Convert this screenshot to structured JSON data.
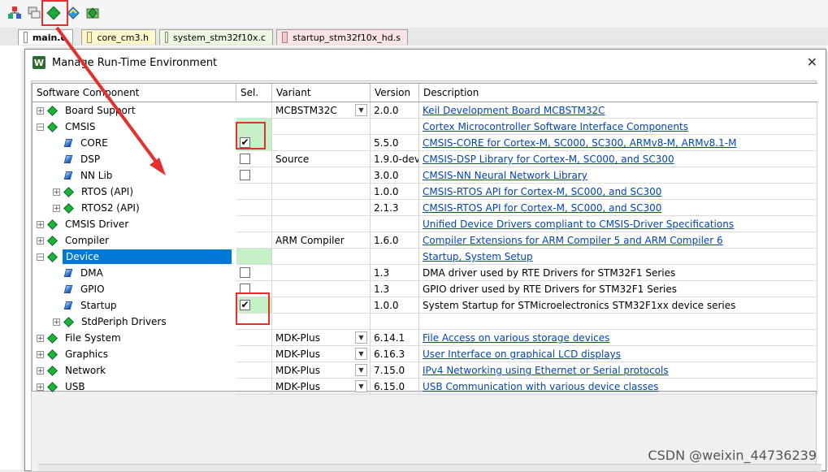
{
  "tabs": [
    {
      "label": "main.c",
      "active": true
    },
    {
      "label": "core_cm3.h",
      "active": false
    },
    {
      "label": "system_stm32f10x.c",
      "active": false
    },
    {
      "label": "startup_stm32f10x_hd.s",
      "active": false
    }
  ],
  "dialog": {
    "icon": "W",
    "title": "Manage Run-Time Environment",
    "close": "✕"
  },
  "columns": {
    "component": "Software Component",
    "sel": "Sel.",
    "variant": "Variant",
    "version": "Version",
    "description": "Description"
  },
  "rows": [
    {
      "level": 0,
      "expander": "+",
      "icon": "green-diamond",
      "name": "Board Support",
      "variant": "MCBSTM32C",
      "has_dropdown": true,
      "version": "2.0.0",
      "desc": "Keil Development Board MCBSTM32C",
      "desc_link": true
    },
    {
      "level": 0,
      "expander": "−",
      "icon": "green-diamond",
      "name": "CMSIS",
      "variant": "",
      "version": "",
      "desc": "Cortex Microcontroller Software Interface Components",
      "desc_link": true,
      "sel_green": true
    },
    {
      "level": 1,
      "icon": "blue-diamond",
      "name": "CORE",
      "checkbox": true,
      "checked": true,
      "sel_green": true,
      "version": "5.5.0",
      "desc": "CMSIS-CORE for Cortex-M, SC000, SC300, ARMv8-M, ARMv8.1-M",
      "desc_link": true
    },
    {
      "level": 1,
      "icon": "blue-diamond",
      "name": "DSP",
      "checkbox": true,
      "checked": false,
      "variant": "Source",
      "version": "1.9.0-dev",
      "desc": "CMSIS-DSP Library for Cortex-M, SC000, and SC300",
      "desc_link": true
    },
    {
      "level": 1,
      "icon": "blue-diamond",
      "name": "NN Lib",
      "checkbox": true,
      "checked": false,
      "version": "3.0.0",
      "desc": "CMSIS-NN Neural Network Library",
      "desc_link": true
    },
    {
      "level": 1,
      "expander": "+",
      "icon": "green-diamond",
      "name": "RTOS (API)",
      "version": "1.0.0",
      "desc": "CMSIS-RTOS API for Cortex-M, SC000, and SC300",
      "desc_link": true
    },
    {
      "level": 1,
      "expander": "+",
      "icon": "green-diamond",
      "name": "RTOS2 (API)",
      "version": "2.1.3",
      "desc": "CMSIS-RTOS API for Cortex-M, SC000, and SC300",
      "desc_link": true
    },
    {
      "level": 0,
      "expander": "+",
      "icon": "green-diamond",
      "name": "CMSIS Driver",
      "version": "",
      "desc": "Unified Device Drivers compliant to CMSIS-Driver Specifications",
      "desc_link": true
    },
    {
      "level": 0,
      "expander": "+",
      "icon": "green-diamond",
      "name": "Compiler",
      "variant": "ARM Compiler",
      "version": "1.6.0",
      "desc": "Compiler Extensions for ARM Compiler 5 and ARM Compiler 6",
      "desc_link": true
    },
    {
      "level": 0,
      "expander": "−",
      "icon": "green-diamond",
      "name": "Device",
      "selected": true,
      "sel_green": true,
      "version": "",
      "desc": "Startup, System Setup",
      "desc_link": true
    },
    {
      "level": 1,
      "icon": "blue-diamond",
      "name": "DMA",
      "checkbox": true,
      "checked": false,
      "version": "1.3",
      "desc": "DMA driver used by RTE Drivers for STM32F1 Series",
      "desc_link": false
    },
    {
      "level": 1,
      "icon": "blue-diamond",
      "name": "GPIO",
      "checkbox": true,
      "checked": false,
      "version": "1.3",
      "desc": "GPIO driver used by RTE Drivers for STM32F1 Series",
      "desc_link": false
    },
    {
      "level": 1,
      "icon": "blue-diamond",
      "name": "Startup",
      "checkbox": true,
      "checked": true,
      "sel_green": true,
      "version": "1.0.0",
      "desc": "System Startup for STMicroelectronics STM32F1xx device series",
      "desc_link": false
    },
    {
      "level": 1,
      "expander": "+",
      "icon": "green-diamond",
      "name": "StdPeriph Drivers",
      "version": "",
      "desc": "",
      "desc_link": false
    },
    {
      "level": 0,
      "expander": "+",
      "icon": "green-diamond",
      "name": "File System",
      "variant": "MDK-Plus",
      "has_dropdown": true,
      "version": "6.14.1",
      "desc": "File Access on various storage devices",
      "desc_link": true
    },
    {
      "level": 0,
      "expander": "+",
      "icon": "green-diamond",
      "name": "Graphics",
      "variant": "MDK-Plus",
      "has_dropdown": true,
      "version": "6.16.3",
      "desc": "User Interface on graphical LCD displays",
      "desc_link": true
    },
    {
      "level": 0,
      "expander": "+",
      "icon": "green-diamond",
      "name": "Network",
      "variant": "MDK-Plus",
      "has_dropdown": true,
      "version": "7.15.0",
      "desc": "IPv4 Networking using Ethernet or Serial protocols",
      "desc_link": true
    },
    {
      "level": 0,
      "expander": "+",
      "icon": "green-diamond",
      "name": "USB",
      "variant": "MDK-Plus",
      "has_dropdown": true,
      "version": "6.15.0",
      "desc": "USB Communication with various device classes",
      "desc_link": true
    }
  ],
  "watermark": "CSDN @weixin_44736239",
  "colors": {
    "highlight_red": "#e53030",
    "selected_blue": "#0078d7",
    "sel_green": "#c6f0c6",
    "link_blue": "#0645ad"
  }
}
